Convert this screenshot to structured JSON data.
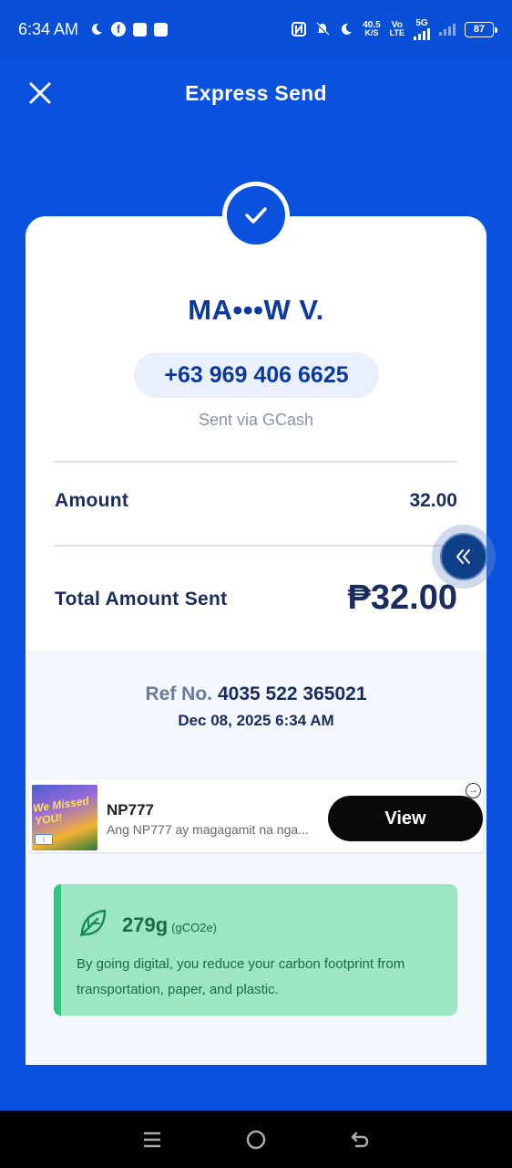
{
  "status_bar": {
    "time": "6:34 AM",
    "net_speed_value": "40.5",
    "net_speed_unit": "K/S",
    "volte_top": "Vo",
    "volte_bottom": "LTE",
    "network": "5G",
    "battery": "87"
  },
  "header": {
    "title": "Express Send"
  },
  "receipt": {
    "recipient_name": "MA•••W V.",
    "phone": "+63 969 406 6625",
    "sent_via": "Sent via GCash",
    "amount_label": "Amount",
    "amount_value": "32.00",
    "total_label": "Total Amount Sent",
    "total_value": "₱32.00",
    "ref_label": "Ref No.",
    "ref_number": "4035 522 365021",
    "date": "Dec 08, 2025 6:34 AM"
  },
  "ad": {
    "thumb_text": "We Missed YOU!",
    "title": "NP777",
    "description": "Ang NP777 ay magagamit na nga...",
    "cta": "View"
  },
  "carbon": {
    "amount": "279g",
    "unit": "(gCO2e)",
    "message": "By going digital, you reduce your carbon footprint from transportation, paper, and plastic."
  },
  "colors": {
    "brand_blue": "#0a52dd",
    "navy_text": "#1a2b5e",
    "carbon_bg": "#9de6c2",
    "carbon_accent": "#2ec77f"
  }
}
